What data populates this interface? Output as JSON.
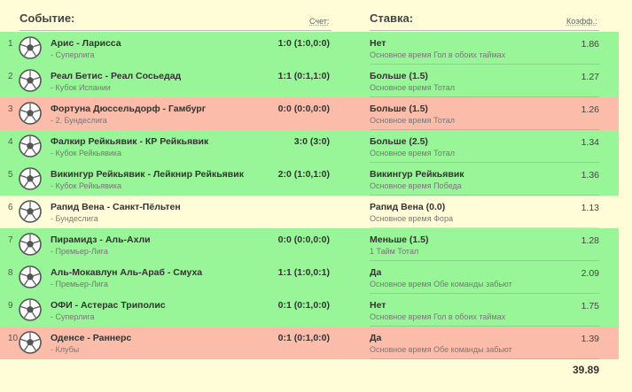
{
  "header": {
    "event_label": "Событие:",
    "score_label": "Счет:",
    "bet_label": "Ставка:",
    "coef_label": "Коэфф.:"
  },
  "colors": {
    "green": "#98f598",
    "red": "#fbbcaa",
    "yellow": "#fffdd7"
  },
  "rows": [
    {
      "num": "1",
      "status": "green",
      "title": "Арис - Ларисса",
      "league": "- Суперлига",
      "score": "1:0 (1:0,0:0)",
      "bet": "Нет",
      "bet_sub": "Основное время Гол в обоих таймах",
      "coef": "1.86"
    },
    {
      "num": "2",
      "status": "green",
      "title": "Реал Бетис - Реал Сосьедад",
      "league": "- Кубок Испании",
      "score": "1:1 (0:1,1:0)",
      "bet": "Больше (1.5)",
      "bet_sub": "Основное время Тотал",
      "coef": "1.27"
    },
    {
      "num": "3",
      "status": "red",
      "title": "Фортуна Дюссельдорф - Гамбург",
      "league": "- 2. Бундеслига",
      "score": "0:0 (0:0,0:0)",
      "bet": "Больше (1.5)",
      "bet_sub": "Основное время Тотал",
      "coef": "1.26"
    },
    {
      "num": "4",
      "status": "green",
      "title": "Фалкир Рейкьявик - КР Рейкьявик",
      "league": "- Кубок Рейкьявика",
      "score": "3:0 (3:0)",
      "bet": "Больше (2.5)",
      "bet_sub": "Основное время Тотал",
      "coef": "1.34"
    },
    {
      "num": "5",
      "status": "green",
      "title": "Викингур Рейкьявик - Лейкнир Рейкьявик",
      "league": "- Кубок Рейкьявика",
      "score": "2:0 (1:0,1:0)",
      "bet": "Викингур Рейкьявик",
      "bet_sub": "Основное время Победа",
      "coef": "1.36"
    },
    {
      "num": "6",
      "status": "yellow",
      "title": "Рапид Вена - Санкт-Пёльтен",
      "league": "- Бундеслига",
      "score": "",
      "bet": "Рапид Вена (0.0)",
      "bet_sub": "Основное время Фора",
      "coef": "1.13"
    },
    {
      "num": "7",
      "status": "green",
      "title": "Пирамидз - Аль-Ахли",
      "league": "- Премьер-Лига",
      "score": "0:0 (0:0,0:0)",
      "bet": "Меньше (1.5)",
      "bet_sub": "1 Тайм Тотал",
      "coef": "1.28"
    },
    {
      "num": "8",
      "status": "green",
      "title": "Аль-Мокавлун Аль-Араб - Смуха",
      "league": "- Премьер-Лига",
      "score": "1:1 (1:0,0:1)",
      "bet": "Да",
      "bet_sub": "Основное время Обе команды забьют",
      "coef": "2.09"
    },
    {
      "num": "9",
      "status": "green",
      "title": "ОФИ - Астерас Триполис",
      "league": "- Суперлига",
      "score": "0:1 (0:1,0:0)",
      "bet": "Нет",
      "bet_sub": "Основное время Гол в обоих таймах",
      "coef": "1.75"
    },
    {
      "num": "10",
      "status": "red",
      "title": "Оденсе - Раннерс",
      "league": "- Клубы",
      "score": "0:1 (0:1,0:0)",
      "bet": "Да",
      "bet_sub": "Основное время Обе команды забьют",
      "coef": "1.39"
    }
  ],
  "total": "39.89"
}
